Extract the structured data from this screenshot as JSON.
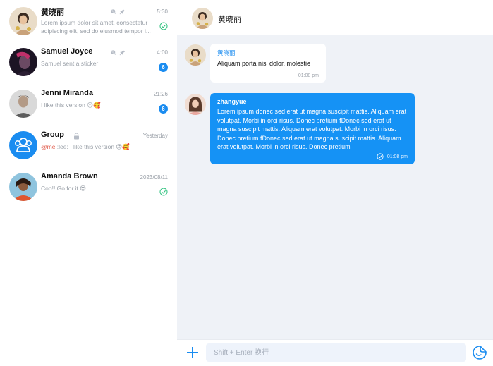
{
  "conversations": [
    {
      "name": "黄晓丽",
      "time": "5:30",
      "preview": "Lorem ipsum dolor sit amet, consectetur adipiscing elit, sed do eiusmod tempor i...",
      "muted": true,
      "pinned": true,
      "status_icon": "double-check-icon",
      "avatar_color": "#c9a27a"
    },
    {
      "name": "Samuel Joyce",
      "time": "4:00",
      "preview": "Samuel sent a sticker",
      "muted": true,
      "pinned": true,
      "unread": "6",
      "avatar_color": "#3b2a4a"
    },
    {
      "name": "Jenni Miranda",
      "time": "21:26",
      "preview": "I like this version 😍🥰",
      "unread": "6",
      "avatar_color": "#8a8a8a"
    },
    {
      "name": "Group",
      "time": "Yesterday",
      "mention": "@me",
      "preview": " :lee: I like this version 😍🥰",
      "locked": true,
      "avatar_color": "#1a8cf0"
    },
    {
      "name": "Amanda Brown",
      "time": "2023/08/11",
      "preview": "Coo!! Go for it 😍",
      "status_icon": "double-check-icon",
      "avatar_color": "#e0552d"
    }
  ],
  "chat": {
    "title": "黄晓丽",
    "messages": [
      {
        "sender": "黄晓丽",
        "text": "Aliquam porta nisl dolor, molestie",
        "time": "01:08 pm"
      },
      {
        "sender": "zhangyue",
        "text": "Lorem ipsum donec sed erat ut magna suscipit mattis. Aliquam erat volutpat. Morbi in orci risus. Donec pretium fDonec sed erat ut magna suscipit mattis. Aliquam erat volutpat. Morbi in orci risus. Donec pretium fDonec sed erat ut magna suscipit mattis. Aliquam erat volutpat. Morbi in orci risus. Donec pretium",
        "time": "01:08 pm"
      }
    ]
  },
  "composer": {
    "placeholder": "Shift + Enter 换行"
  },
  "colors": {
    "accent": "#1a8cf0",
    "outgoing_bubble": "#1592f5",
    "chat_background": "#eff2f7",
    "read_check": "#2ec27e",
    "mention": "#e05a4a"
  }
}
